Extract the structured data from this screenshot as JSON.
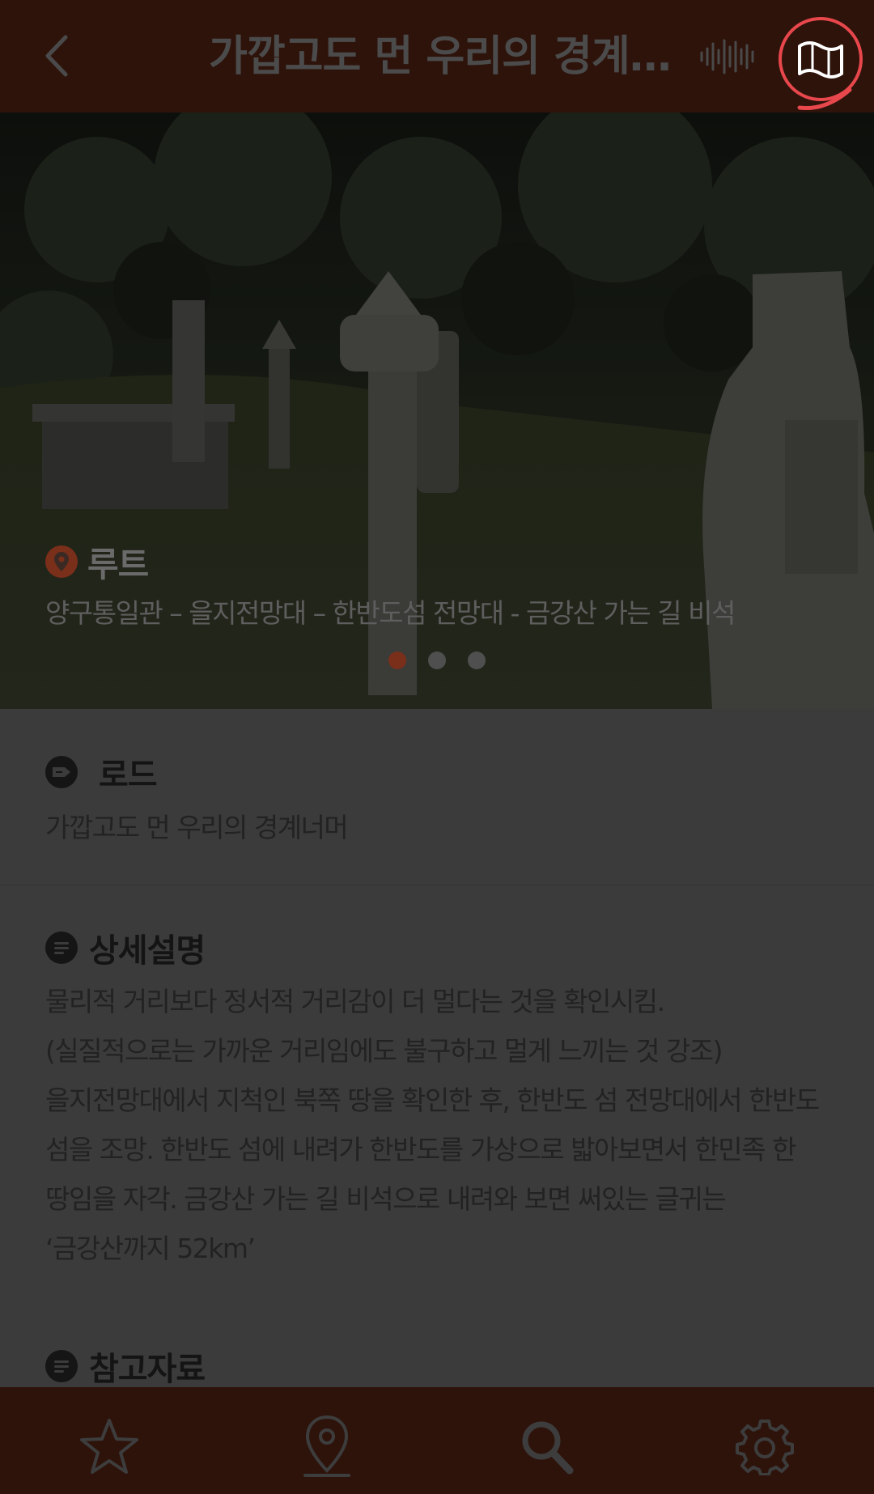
{
  "header": {
    "back_icon": "chevron-left-icon",
    "title": "가깝고도 먼 우리의 경계…",
    "audio_icon": "audio-wave-icon",
    "map_icon": "map-icon",
    "accent_color": "#e8474c",
    "bar_color": "#2e130b"
  },
  "hero": {
    "route_icon": "location-pin-icon",
    "route_title": "루트",
    "route_text": "양구통일관 – 을지전망대 – 한반도섬 전망대 - 금강산 가는 길 비석",
    "carousel": {
      "count": 3,
      "active": 1,
      "active_color": "#7a2f1a"
    }
  },
  "road": {
    "icon": "tag-icon",
    "title": "로드",
    "text": "가깝고도 먼 우리의 경계너머"
  },
  "description": {
    "icon": "list-icon",
    "title": "상세설명",
    "lines": [
      "물리적 거리보다 정서적 거리감이 더 멀다는 것을 확인시킴.",
      "(실질적으로는 가까운 거리임에도 불구하고 멀게 느끼는 것 강조)",
      "을지전망대에서 지척인 북쪽 땅을 확인한 후, 한반도 섬 전망대에서 한반도",
      "섬을 조망. 한반도 섬에 내려가 한반도를 가상으로 밟아보면서 한민족 한",
      "땅임을 자각. 금강산 가는 길 비석으로 내려와 보면 써있는 글귀는",
      "‘금강산까지 52km’"
    ]
  },
  "references": {
    "icon": "list-icon",
    "title": "참고자료"
  },
  "bottom_nav": [
    {
      "name": "favorites",
      "icon": "star-icon"
    },
    {
      "name": "location",
      "icon": "location-pin-icon"
    },
    {
      "name": "search",
      "icon": "search-icon"
    },
    {
      "name": "settings",
      "icon": "gear-icon"
    }
  ]
}
